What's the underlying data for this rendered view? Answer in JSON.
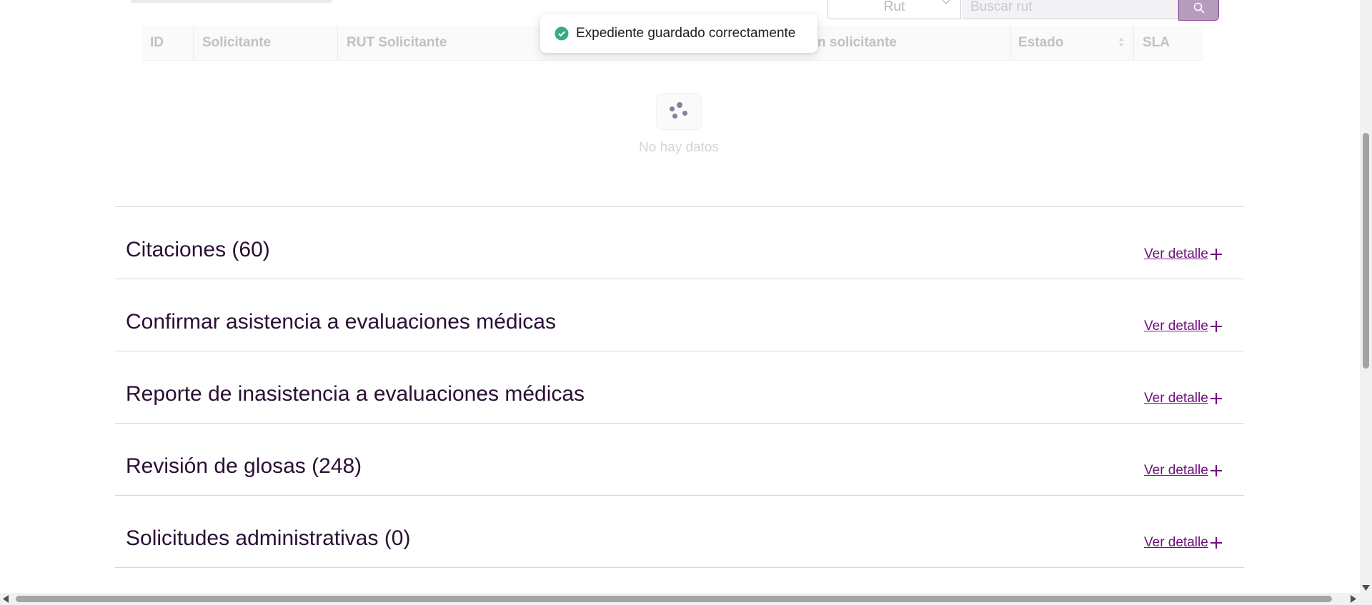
{
  "filter": {
    "select_value": "Rut",
    "search_placeholder": "Buscar rut"
  },
  "table": {
    "columns": [
      "ID",
      "Solicitante",
      "RUT Solicitante",
      "n solicitante",
      "Estado",
      "SLA"
    ],
    "empty_text": "No hay datos"
  },
  "toast": {
    "message": "Expediente guardado correctamente"
  },
  "sections": [
    {
      "title": "Citaciones (60)",
      "link": "Ver detalle"
    },
    {
      "title": "Confirmar asistencia a evaluaciones médicas",
      "link": "Ver detalle"
    },
    {
      "title": "Reporte de inasistencia a evaluaciones médicas",
      "link": "Ver detalle"
    },
    {
      "title": "Revisión de glosas (248)",
      "link": "Ver detalle"
    },
    {
      "title": "Solicitudes administrativas (0)",
      "link": "Ver detalle"
    }
  ],
  "colors": {
    "accent": "#6e0f7d",
    "success": "#3aa98b"
  }
}
